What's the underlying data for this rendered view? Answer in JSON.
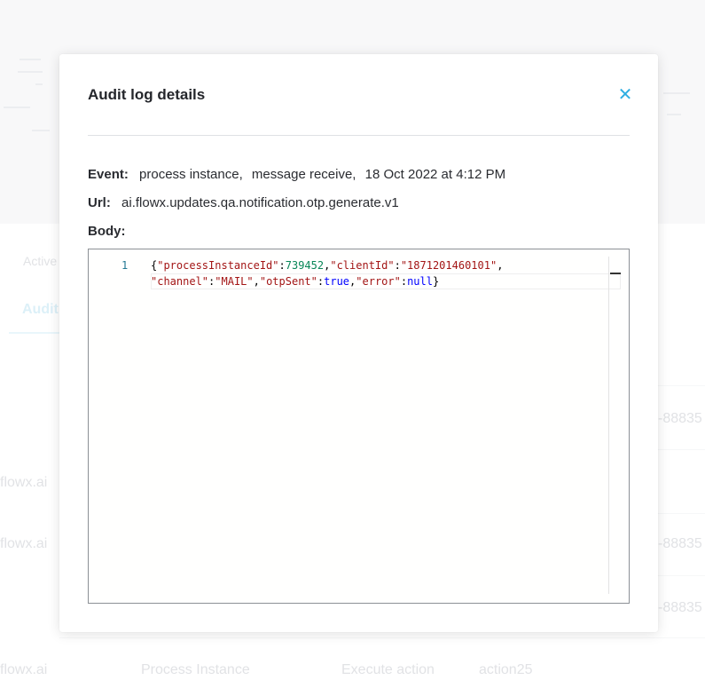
{
  "background": {
    "tab_inactive": "Active",
    "tab_active": "Audit",
    "rows": [
      {
        "email": "flowx.ai",
        "id": "-88835"
      },
      {
        "email": "flowx.ai",
        "id": "-88835"
      },
      {
        "email": "",
        "id": "-88835"
      }
    ],
    "last_row": {
      "email": "flowx.ai",
      "subject": "Process Instance",
      "event": "Execute action",
      "action": "action25"
    }
  },
  "modal": {
    "title": "Audit log details",
    "close_icon": "close-icon",
    "event": {
      "label": "Event:",
      "subject": "process instance,",
      "type": "message receive,",
      "date": "18 Oct 2022 at 4:12 PM"
    },
    "url": {
      "label": "Url:",
      "value": "ai.flowx.updates.qa.notification.otp.generate.v1"
    },
    "body": {
      "label": "Body:",
      "line_number": "1",
      "json": {
        "processInstanceId_key": "\"processInstanceId\"",
        "processInstanceId_value": "739452",
        "clientId_key": "\"clientId\"",
        "clientId_value": "\"1871201460101\"",
        "channel_key": "\"channel\"",
        "channel_value": "\"MAIL\"",
        "otpSent_key": "\"otpSent\"",
        "otpSent_value": "true",
        "error_key": "\"error\"",
        "error_value": "null"
      }
    }
  },
  "colors": {
    "accent": "#2eaee2",
    "json_key": "#a31515",
    "json_number": "#098658",
    "json_literal": "#0000ff",
    "line_number": "#237893"
  }
}
